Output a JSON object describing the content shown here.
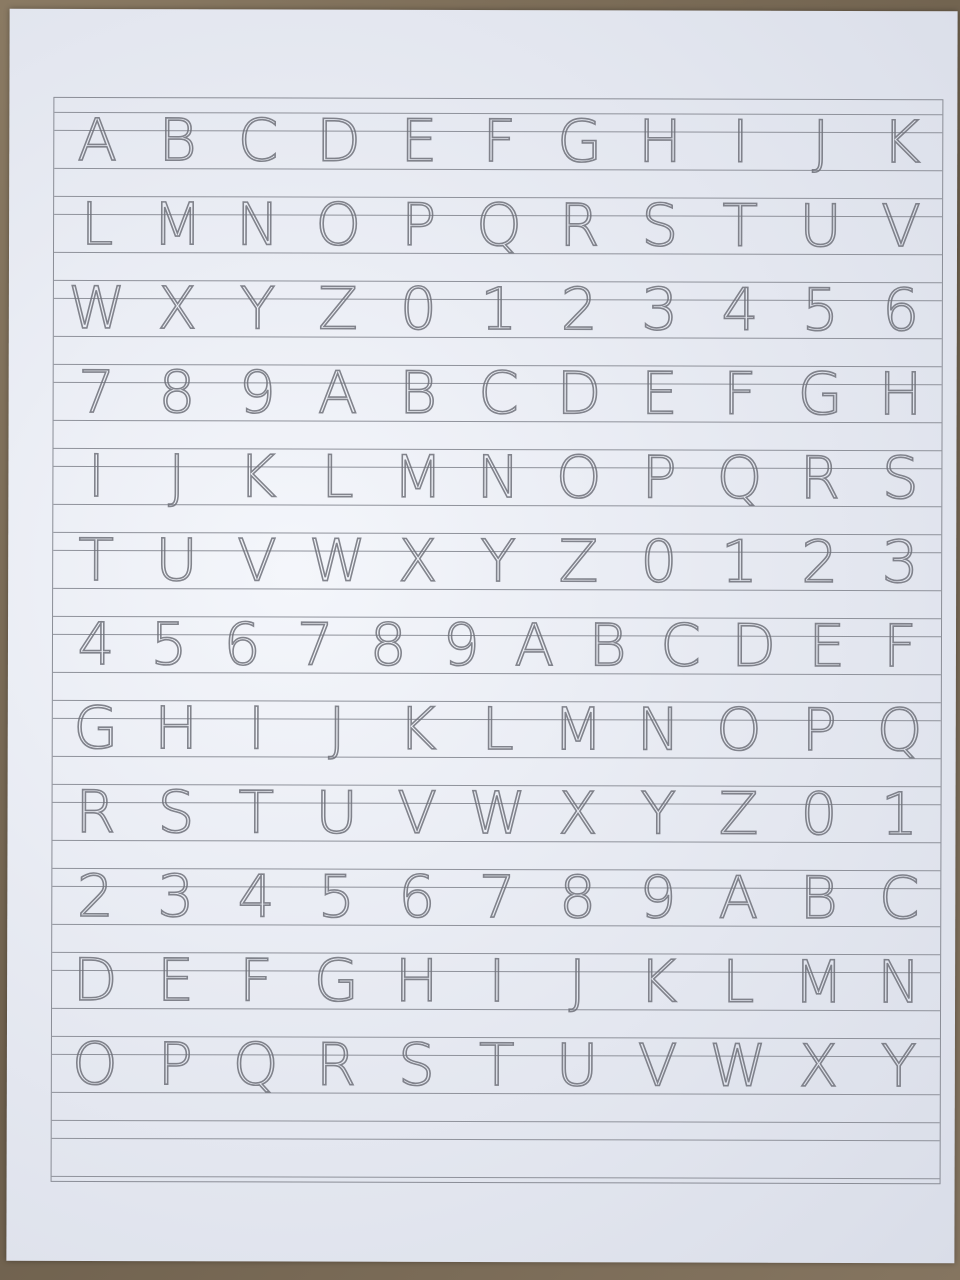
{
  "practice_sheet": {
    "rows": [
      [
        "A",
        "B",
        "C",
        "D",
        "E",
        "F",
        "G",
        "H",
        "I",
        "J",
        "K"
      ],
      [
        "L",
        "M",
        "N",
        "O",
        "P",
        "Q",
        "R",
        "S",
        "T",
        "U",
        "V"
      ],
      [
        "W",
        "X",
        "Y",
        "Z",
        "0",
        "1",
        "2",
        "3",
        "4",
        "5",
        "6"
      ],
      [
        "7",
        "8",
        "9",
        "A",
        "B",
        "C",
        "D",
        "E",
        "F",
        "G",
        "H"
      ],
      [
        "I",
        "J",
        "K",
        "L",
        "M",
        "N",
        "O",
        "P",
        "Q",
        "R",
        "S"
      ],
      [
        "T",
        "U",
        "V",
        "W",
        "X",
        "Y",
        "Z",
        "0",
        "1",
        "2",
        "3"
      ],
      [
        "4",
        "5",
        "6",
        "7",
        "8",
        "9",
        "A",
        "B",
        "C",
        "D",
        "E",
        "F"
      ],
      [
        "G",
        "H",
        "I",
        "J",
        "K",
        "L",
        "M",
        "N",
        "O",
        "P",
        "Q"
      ],
      [
        "R",
        "S",
        "T",
        "U",
        "V",
        "W",
        "X",
        "Y",
        "Z",
        "0",
        "1"
      ],
      [
        "2",
        "3",
        "4",
        "5",
        "6",
        "7",
        "8",
        "9",
        "A",
        "B",
        "C"
      ],
      [
        "D",
        "E",
        "F",
        "G",
        "H",
        "I",
        "J",
        "K",
        "L",
        "M",
        "N"
      ],
      [
        "O",
        "P",
        "Q",
        "R",
        "S",
        "T",
        "U",
        "V",
        "W",
        "X",
        "Y"
      ]
    ]
  }
}
